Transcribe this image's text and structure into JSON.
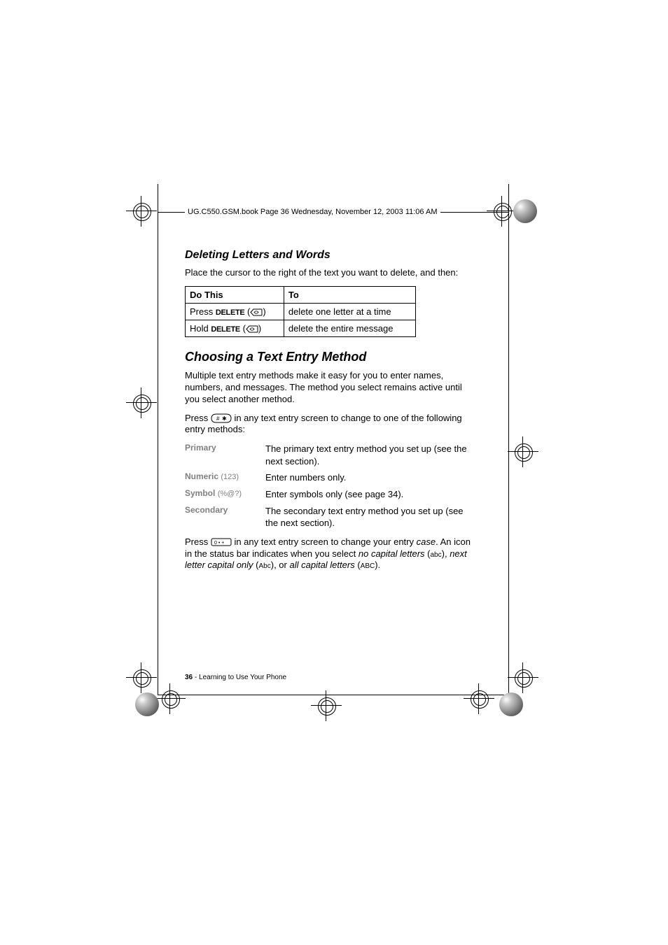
{
  "header_line": "UG.C550.GSM.book  Page 36  Wednesday, November 12, 2003  11:06 AM",
  "section1_title": "Deleting Letters and Words",
  "section1_intro": "Place the cursor to the right of the text you want to delete, and then:",
  "table": {
    "headers": [
      "Do This",
      "To"
    ],
    "rows": [
      {
        "action_prefix": "Press ",
        "action_key": "DELETE",
        "result": "delete one letter at a time"
      },
      {
        "action_prefix": "Hold ",
        "action_key": "DELETE",
        "result": "delete the entire message"
      }
    ]
  },
  "section2_title": "Choosing a Text Entry Method",
  "section2_p1": "Multiple text entry methods make it easy for you to enter names, numbers, and messages. The method you select remains active until you select another method.",
  "section2_p2a": "Press ",
  "section2_p2b": " in any text entry screen to change to one of the following entry methods:",
  "methods": [
    {
      "label": "Primary",
      "suffix": "",
      "desc": "The primary text entry method you set up (see the next section)."
    },
    {
      "label": "Numeric",
      "suffix": "(123)",
      "desc": "Enter numbers only."
    },
    {
      "label": "Symbol",
      "suffix": "(%@?)",
      "desc": "Enter symbols only (see page 34)."
    },
    {
      "label": "Secondary",
      "suffix": "",
      "desc": "The secondary text entry method you set up (see the next section)."
    }
  ],
  "section2_p3a": "Press ",
  "section2_p3b": " in any text entry screen to change your entry ",
  "section2_p3_case": "case",
  "section2_p3c": ". An icon in the status bar indicates when you select ",
  "section2_p3_nc": "no capital letters",
  "section2_p3d": " (",
  "icon_abc_lower": "abc",
  "section2_p3e": "), ",
  "section2_p3_nl": "next letter capital only",
  "section2_p3f": " (",
  "icon_abc_mixed": "Abc",
  "section2_p3g": "), or ",
  "section2_p3_ac": "all capital letters",
  "section2_p3h": " (",
  "icon_abc_upper": "ABC",
  "section2_p3i": ").",
  "footer": {
    "page": "36",
    "sep": " - ",
    "chapter": "Learning to Use Your Phone"
  }
}
